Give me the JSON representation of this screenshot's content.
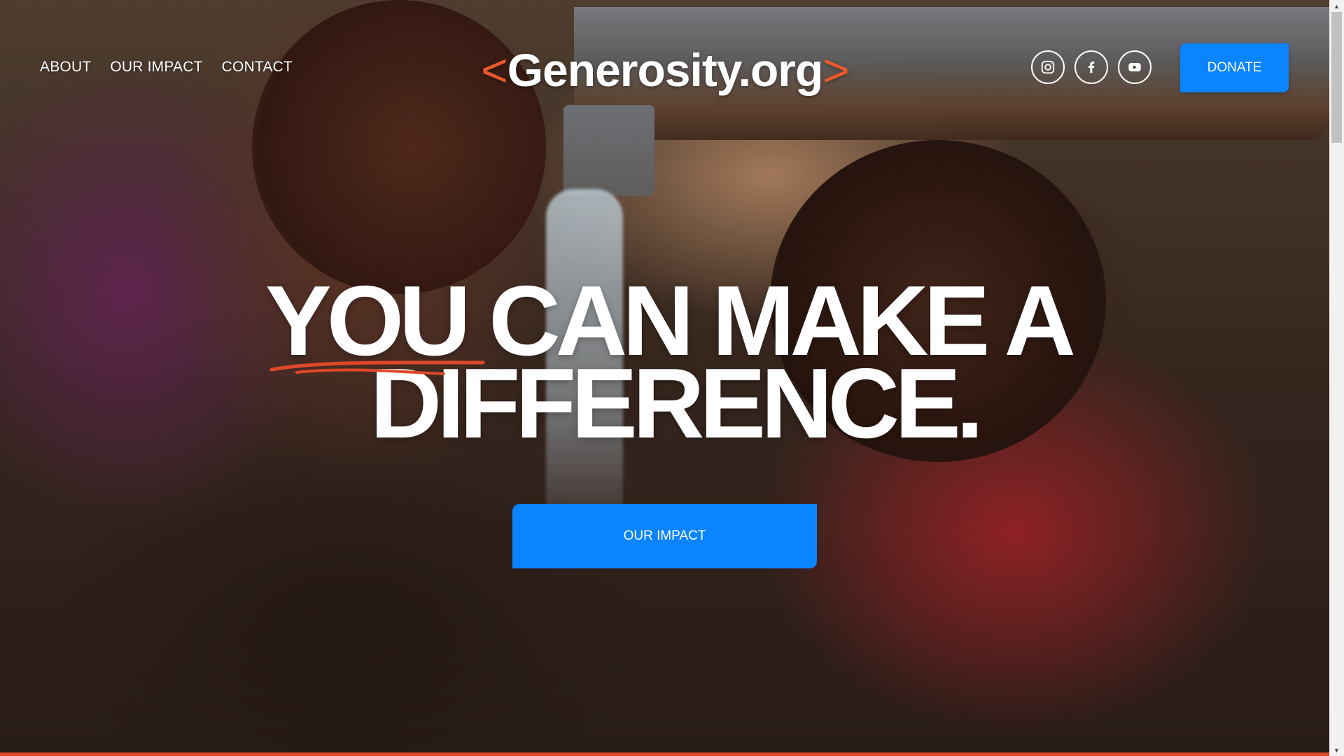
{
  "nav": {
    "items": [
      {
        "label": "ABOUT"
      },
      {
        "label": "OUR IMPACT"
      },
      {
        "label": "CONTACT"
      }
    ]
  },
  "logo": {
    "open_bracket": "<",
    "text": "Generosity.org",
    "close_bracket": ">"
  },
  "socials": [
    {
      "icon": "instagram-icon"
    },
    {
      "icon": "facebook-icon"
    },
    {
      "icon": "youtube-icon"
    }
  ],
  "header": {
    "donate_label": "DONATE"
  },
  "hero": {
    "headline_line1": "YOU CAN MAKE A",
    "headline_line2": "DIFFERENCE.",
    "cta_label": "OUR IMPACT"
  },
  "colors": {
    "accent_blue": "#0a84ff",
    "accent_orange": "#e85a2c",
    "text": "#ffffff"
  }
}
